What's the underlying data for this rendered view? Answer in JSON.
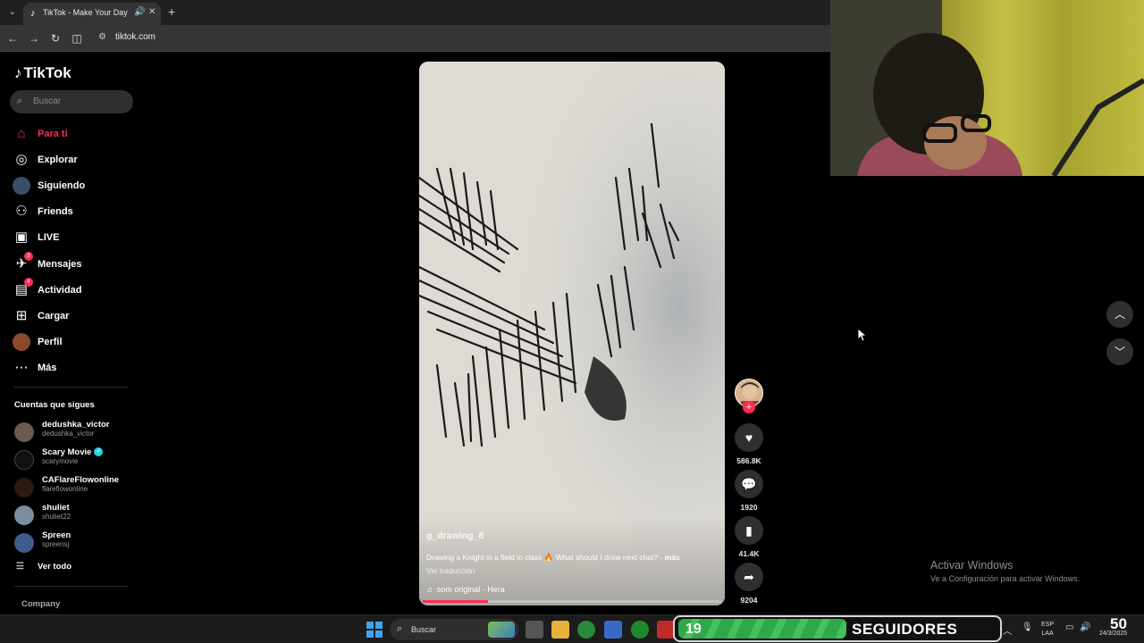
{
  "browser": {
    "tab_title": "TikTok - Make Your Day",
    "url": "tiktok.com"
  },
  "sidebar": {
    "logo": "TikTok",
    "search_placeholder": "Buscar",
    "nav": [
      {
        "label": "Para ti",
        "icon": "home-icon",
        "active": true
      },
      {
        "label": "Explorar",
        "icon": "compass-icon"
      },
      {
        "label": "Siguiendo",
        "icon": "following-avatar-icon"
      },
      {
        "label": "Friends",
        "icon": "friends-icon"
      },
      {
        "label": "LIVE",
        "icon": "live-icon"
      },
      {
        "label": "Mensajes",
        "icon": "messages-icon",
        "badge": "3"
      },
      {
        "label": "Actividad",
        "icon": "activity-icon",
        "badge": "4"
      },
      {
        "label": "Cargar",
        "icon": "upload-icon"
      },
      {
        "label": "Perfil",
        "icon": "profile-avatar-icon"
      },
      {
        "label": "Más",
        "icon": "more-icon"
      }
    ],
    "following_title": "Cuentas que sigues",
    "accounts": [
      {
        "name": "dedushka_victor",
        "handle": "dedushka_victor"
      },
      {
        "name": "Scary Movie",
        "handle": "scarymovie",
        "verified": true
      },
      {
        "name": "CAFlareFlowonline",
        "handle": "flareflowonline"
      },
      {
        "name": "shuliet",
        "handle": "shuliet22"
      },
      {
        "name": "Spreen",
        "handle": "spreensj"
      }
    ],
    "see_all": "Ver todo",
    "company": "Company"
  },
  "video": {
    "author": "g_drawing_8",
    "caption": "Drawing a Knight in a field in class 🔥 What should I draw next chat? -",
    "more": "más",
    "translate": "Ver traducción",
    "music": "som original - Hera",
    "progress": 0.22
  },
  "actions": {
    "likes": "586.8K",
    "comments": "1920",
    "saves": "41.4K",
    "shares": "9204"
  },
  "watermark": {
    "title": "Activar Windows",
    "subtitle": "Ve a Configuración para activar Windows."
  },
  "taskbar": {
    "search": "Buscar",
    "followers_count": "19",
    "followers_label": "SEGUIDORES",
    "lang_top": "ESP",
    "lang_bottom": "LAA",
    "clock": "50",
    "date": "24/3/2025"
  },
  "colors": {
    "accent": "#fe2c55",
    "verified": "#20d5ec",
    "follower_bar": "#43c25c"
  }
}
